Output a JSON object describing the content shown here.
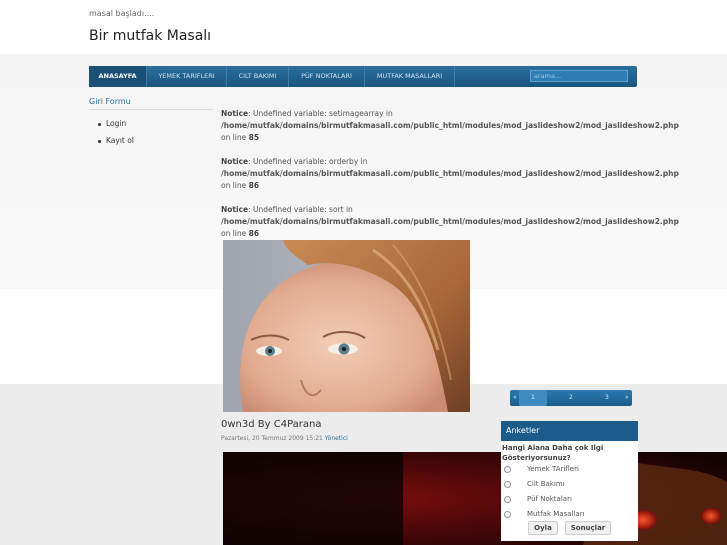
{
  "header": {
    "tagline": "masal başladı....",
    "site_title": "Bir mutfak Masalı"
  },
  "nav": {
    "items": [
      "ANASAYFA",
      "YEMEK TARIFLERI",
      "CILT BAKIMI",
      "PÜF NOKTALARI",
      "MUTFAK MASALLARI"
    ],
    "search_placeholder": "arama..."
  },
  "sidebar": {
    "title": "Giri Formu",
    "links": [
      "Login",
      "Kayıt ol"
    ]
  },
  "notices": [
    {
      "label": "Notice",
      "message": ": Undefined variable: setimagearray in",
      "path": "/home/mutfak/domains/birmutfakmasali.com/public_html/modules/mod_jaslideshow2/mod_jaslideshow2.php",
      "line_prefix": "on line",
      "line": "85"
    },
    {
      "label": "Notice",
      "message": ": Undefined variable: orderby in",
      "path": "/home/mutfak/domains/birmutfakmasali.com/public_html/modules/mod_jaslideshow2/mod_jaslideshow2.php",
      "line_prefix": "on line",
      "line": "86"
    },
    {
      "label": "Notice",
      "message": ": Undefined variable: sort in",
      "path": "/home/mutfak/domains/birmutfakmasali.com/public_html/modules/mod_jaslideshow2/mod_jaslideshow2.php",
      "line_prefix": "on line",
      "line": "86"
    }
  ],
  "pager": {
    "prev": "«",
    "pages": [
      "1",
      "2",
      "3"
    ],
    "next": "»"
  },
  "article": {
    "title": "0wn3d By C4Parana",
    "date": "Pazartesi, 20 Temmuz 2009 15:21",
    "author": "Yönetici"
  },
  "poll": {
    "heading": "Anketler",
    "question": "Hangi Alana Daha çok Ilgi Gösteriyorsunuz?",
    "options": [
      "Yemek TArifleri",
      "Cilt Bakımı",
      "Püf Noktaları",
      "Mutfak Masalları"
    ],
    "vote_label": "Oyla",
    "results_label": "Sonuçlar"
  }
}
